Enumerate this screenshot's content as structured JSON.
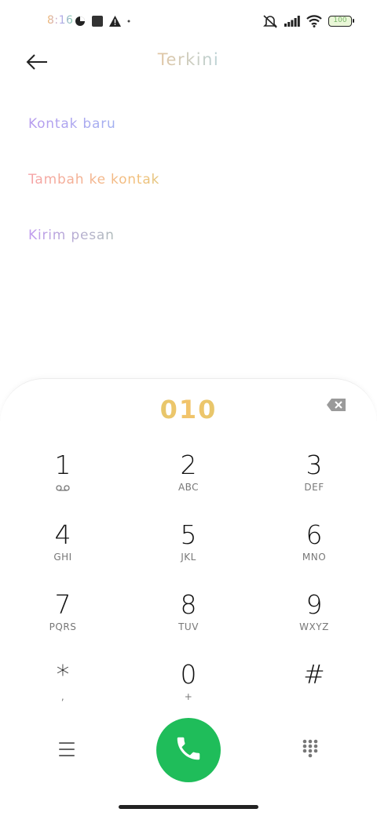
{
  "status_bar": {
    "time": "8:16",
    "battery": "100",
    "left_icons": [
      "vpn-icon",
      "square-app-icon",
      "warning-icon",
      "dot-icon"
    ],
    "right_icons": [
      "mute-icon",
      "signal-icon",
      "wifi-icon",
      "battery-icon"
    ]
  },
  "header": {
    "title": "Terkini",
    "back_icon": "arrow-left-icon"
  },
  "menu": {
    "items": [
      {
        "label": "Kontak baru"
      },
      {
        "label": "Tambah ke kontak"
      },
      {
        "label": "Kirim pesan"
      }
    ]
  },
  "dialer": {
    "number": "010",
    "keys": [
      {
        "digit": "1",
        "letters": "",
        "icon": "voicemail-icon"
      },
      {
        "digit": "2",
        "letters": "ABC"
      },
      {
        "digit": "3",
        "letters": "DEF"
      },
      {
        "digit": "4",
        "letters": "GHI"
      },
      {
        "digit": "5",
        "letters": "JKL"
      },
      {
        "digit": "6",
        "letters": "MNO"
      },
      {
        "digit": "7",
        "letters": "PQRS"
      },
      {
        "digit": "8",
        "letters": "TUV"
      },
      {
        "digit": "9",
        "letters": "WXYZ"
      },
      {
        "digit": "*",
        "letters": ","
      },
      {
        "digit": "0",
        "letters": "+"
      },
      {
        "digit": "#",
        "letters": ""
      }
    ]
  },
  "colors": {
    "call_button": "#1fbd5a",
    "sub_text": "#777777"
  }
}
